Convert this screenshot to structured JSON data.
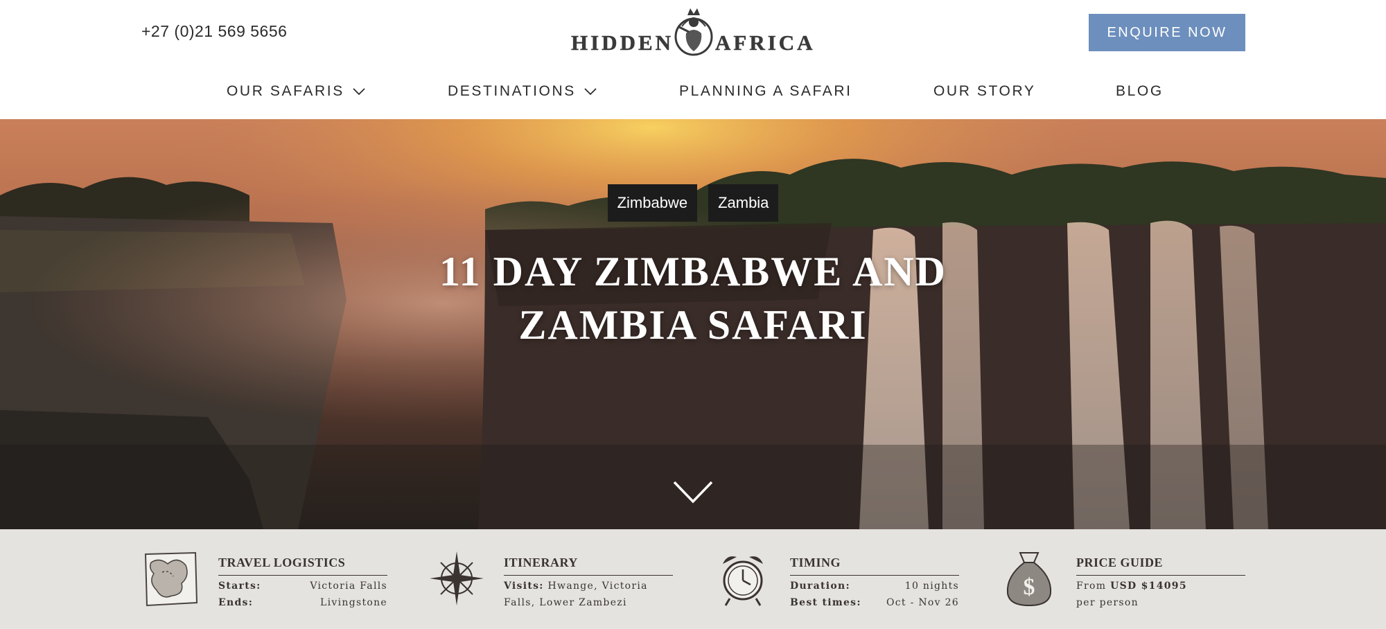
{
  "header": {
    "phone": "+27 (0)21 569 5656",
    "logo": {
      "left_word": "HIDDEN",
      "right_word": "AFRICA"
    },
    "enquire_label": "ENQUIRE NOW"
  },
  "nav": [
    {
      "label": "OUR SAFARIS",
      "has_dropdown": true
    },
    {
      "label": "DESTINATIONS",
      "has_dropdown": true
    },
    {
      "label": "PLANNING A SAFARI",
      "has_dropdown": false
    },
    {
      "label": "OUR STORY",
      "has_dropdown": false
    },
    {
      "label": "BLOG",
      "has_dropdown": false
    }
  ],
  "hero": {
    "tags": [
      "Zimbabwe",
      "Zambia"
    ],
    "title_line1": "11 DAY ZIMBABWE AND",
    "title_line2": "ZAMBIA SAFARI",
    "scroll_icon": "chevron-down-icon"
  },
  "info": {
    "logistics": {
      "icon": "map-icon",
      "title": "TRAVEL LOGISTICS",
      "starts_label": "Starts:",
      "starts_value": "Victoria Falls",
      "ends_label": "Ends:",
      "ends_value": "Livingstone"
    },
    "itinerary": {
      "icon": "compass-icon",
      "title": "ITINERARY",
      "visits_label": "Visits:",
      "visits_value": "Hwange, Victoria Falls, Lower Zambezi"
    },
    "timing": {
      "icon": "alarm-clock-icon",
      "title": "TIMING",
      "duration_label": "Duration:",
      "duration_value": "10 nights",
      "best_label": "Best times:",
      "best_value": "Oct - Nov 26"
    },
    "price": {
      "icon": "money-bag-icon",
      "title": "PRICE GUIDE",
      "from_label": "From",
      "amount": "USD $14095",
      "per": "per person"
    }
  },
  "colors": {
    "accent": "#6d8fbd",
    "tag_bg": "#1c1c1c",
    "infobar_bg": "#e4e3e0"
  }
}
